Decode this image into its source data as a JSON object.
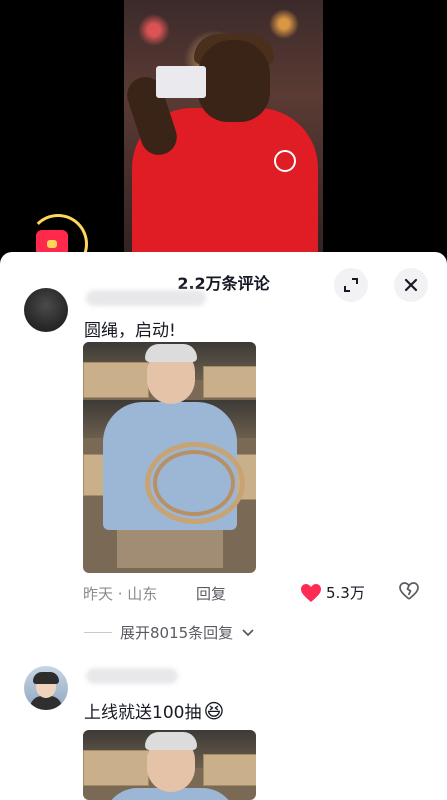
{
  "header": {
    "title": "2.2万条评论"
  },
  "comments": [
    {
      "text": "圆绳，启动!",
      "time": "昨天 · 山东",
      "reply_label": "回复",
      "like_count": "5.3万",
      "expand_label": "展开8015条回复"
    },
    {
      "text": "上线就送100抽",
      "emoji": "😆"
    }
  ],
  "colors": {
    "like": "#fe2c55",
    "sheet_bg": "#ffffff",
    "text": "#161823"
  }
}
